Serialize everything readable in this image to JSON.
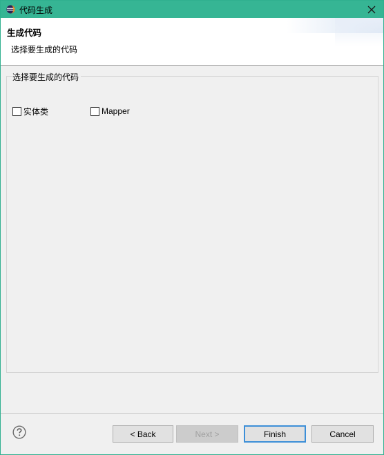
{
  "window": {
    "title": "代码生成",
    "close_glyph": "✕"
  },
  "banner": {
    "title": "生成代码",
    "description": "选择要生成的代码"
  },
  "group": {
    "label": "选择要生成的代码",
    "options": [
      {
        "label": "实体类",
        "checked": false
      },
      {
        "label": "Mapper",
        "checked": false
      }
    ]
  },
  "buttons": {
    "back": "< Back",
    "next": "Next >",
    "finish": "Finish",
    "cancel": "Cancel"
  },
  "icons": {
    "help": "help-icon",
    "app": "eclipse-icon",
    "close": "close-icon"
  },
  "colors": {
    "titlebar": "#36b594",
    "default_button_border": "#3c8fd8"
  }
}
